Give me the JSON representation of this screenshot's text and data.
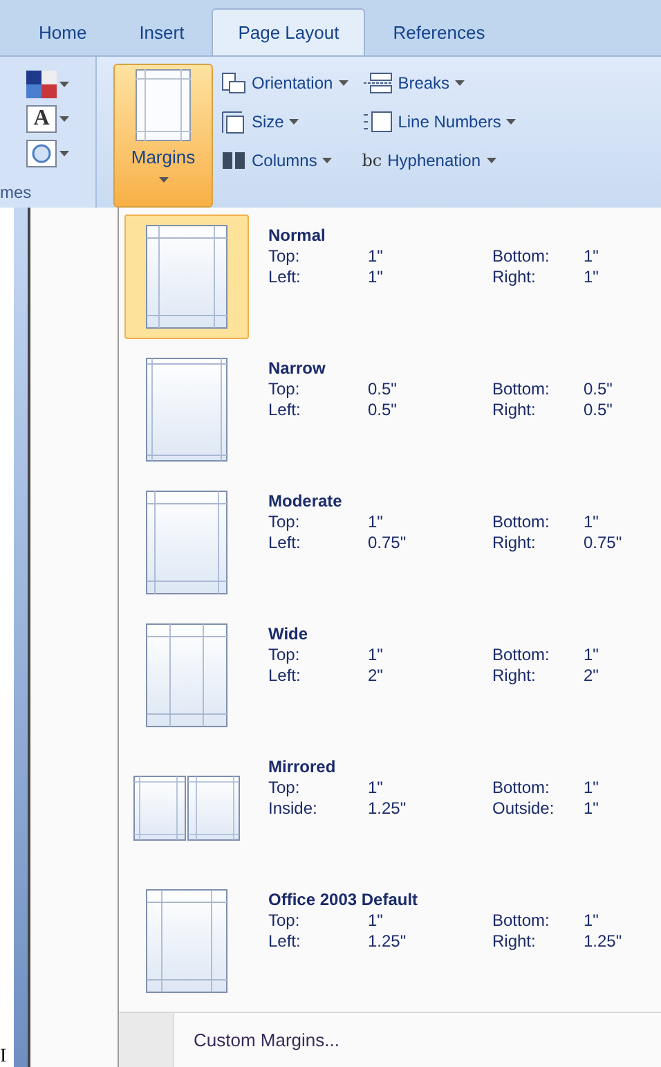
{
  "tabs": [
    {
      "label": "Home",
      "selected": false
    },
    {
      "label": "Insert",
      "selected": false
    },
    {
      "label": "Page Layout",
      "selected": true
    },
    {
      "label": "References",
      "selected": false
    }
  ],
  "themes_group": {
    "label": "mes",
    "buttons": [
      {
        "kind": "colors"
      },
      {
        "kind": "fonts",
        "label": "A"
      },
      {
        "kind": "effects"
      }
    ]
  },
  "margins_button": {
    "label": "Margins",
    "expanded": true
  },
  "page_setup": [
    {
      "kind": "orientation",
      "label": "Orientation"
    },
    {
      "kind": "breaks",
      "label": "Breaks"
    },
    {
      "kind": "size",
      "label": "Size"
    },
    {
      "kind": "line_numbers",
      "label": "Line Numbers"
    },
    {
      "kind": "columns",
      "label": "Columns"
    },
    {
      "kind": "hyphenation",
      "label": "Hyphenation",
      "glyph": "bc"
    }
  ],
  "margins_menu": {
    "items": [
      {
        "kind": "normal",
        "name": "Normal",
        "selected": true,
        "rows": [
          [
            "Top:",
            "1\"",
            "Bottom:",
            "1\""
          ],
          [
            "Left:",
            "1\"",
            "Right:",
            "1\""
          ]
        ]
      },
      {
        "kind": "narrow",
        "name": "Narrow",
        "selected": false,
        "rows": [
          [
            "Top:",
            "0.5\"",
            "Bottom:",
            "0.5\""
          ],
          [
            "Left:",
            "0.5\"",
            "Right:",
            "0.5\""
          ]
        ]
      },
      {
        "kind": "moderate",
        "name": "Moderate",
        "selected": false,
        "rows": [
          [
            "Top:",
            "1\"",
            "Bottom:",
            "1\""
          ],
          [
            "Left:",
            "0.75\"",
            "Right:",
            "0.75\""
          ]
        ]
      },
      {
        "kind": "wide",
        "name": "Wide",
        "selected": false,
        "rows": [
          [
            "Top:",
            "1\"",
            "Bottom:",
            "1\""
          ],
          [
            "Left:",
            "2\"",
            "Right:",
            "2\""
          ]
        ]
      },
      {
        "kind": "mirrored",
        "name": "Mirrored",
        "selected": false,
        "rows": [
          [
            "Top:",
            "1\"",
            "Bottom:",
            "1\""
          ],
          [
            "Inside:",
            "1.25\"",
            "Outside:",
            "1\""
          ]
        ]
      },
      {
        "kind": "office",
        "name": "Office 2003 Default",
        "selected": false,
        "rows": [
          [
            "Top:",
            "1\"",
            "Bottom:",
            "1\""
          ],
          [
            "Left:",
            "1.25\"",
            "Right:",
            "1.25\""
          ]
        ]
      }
    ],
    "custom": "Custom Margins..."
  },
  "cursor_text": "I"
}
